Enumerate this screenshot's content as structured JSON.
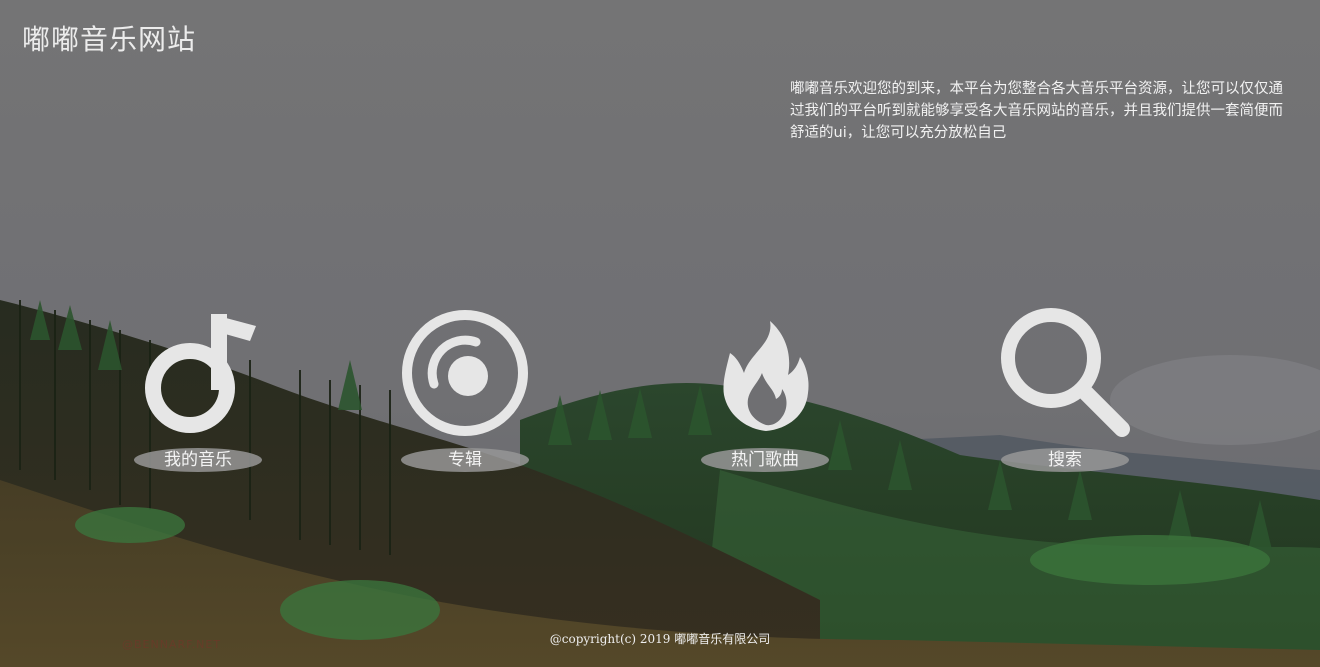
{
  "header": {
    "site_title": "嘟嘟音乐网站"
  },
  "intro": {
    "text": "嘟嘟音乐欢迎您的到来，本平台为您整合各大音乐平台资源，让您可以仅仅通过我们的平台听到就能够享受各大音乐网站的音乐，并且我们提供一套简便而舒适的ui，让您可以充分放松自己"
  },
  "nav": {
    "items": [
      {
        "label": "我的音乐",
        "icon": "music-note-icon"
      },
      {
        "label": "专辑",
        "icon": "disc-icon"
      },
      {
        "label": "热门歌曲",
        "icon": "flame-icon"
      },
      {
        "label": "搜索",
        "icon": "search-icon"
      }
    ]
  },
  "footer": {
    "copyright": "@copyright(c) 2019 嘟嘟音乐有限公司"
  },
  "watermark": {
    "text": "@BENNARF.NET"
  },
  "colors": {
    "icon": "#e6e6e6",
    "label_bg": "#969696",
    "text": "#f2f2f2"
  }
}
